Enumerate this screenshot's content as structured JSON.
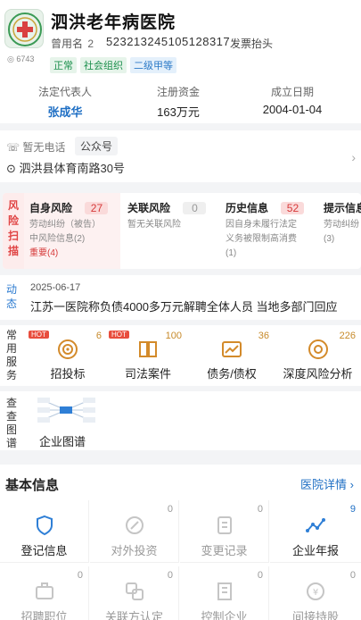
{
  "company": {
    "name": "泗洪老年病医院",
    "former_label": "曾用名",
    "former_count": "2",
    "credit_code": "523213245105128317",
    "invoice_label": "发票抬头",
    "views": "6743",
    "tags": [
      "正常",
      "社会组织",
      "二级甲等"
    ]
  },
  "kpis": [
    {
      "label": "法定代表人",
      "value": "张成华"
    },
    {
      "label": "注册资金",
      "value": "163万元"
    },
    {
      "label": "成立日期",
      "value": "2004-01-04"
    }
  ],
  "contact": {
    "phone": "暂无电话",
    "wechat": "公众号",
    "address": "泗洪县体育南路30号"
  },
  "risk": {
    "side_label": [
      "风",
      "险",
      "扫",
      "描"
    ],
    "columns": [
      {
        "title": "自身风险",
        "count": "27",
        "lines": [
          "劳动纠纷（被告）",
          "中风险信息(2)"
        ],
        "alert": "重要(4)"
      },
      {
        "title": "关联风险",
        "count": "0",
        "lines": [
          "",
          "暂无关联风险"
        ],
        "alert": ""
      },
      {
        "title": "历史信息",
        "count": "52",
        "lines": [
          "因自身未履行法定",
          "义务被限制高消费",
          "(1)"
        ],
        "alert": ""
      },
      {
        "title": "提示信息",
        "count": "",
        "lines": [
          "劳动纠纷",
          "(3)"
        ],
        "alert": ""
      }
    ]
  },
  "dynamic": {
    "side_label": [
      "动",
      "态"
    ],
    "date": "2025-06-17",
    "text": "江苏一医院称负债4000多万元解聘全体人员 当地多部门回应"
  },
  "services": {
    "side_label": [
      "常",
      "用",
      "服",
      "务"
    ],
    "items": [
      {
        "label": "招投标",
        "count": "6",
        "hot": "HOT"
      },
      {
        "label": "司法案件",
        "count": "100",
        "hot": "HOT"
      },
      {
        "label": "债务/债权",
        "count": "36",
        "hot": ""
      },
      {
        "label": "深度风险分析",
        "count": "226",
        "hot": ""
      }
    ]
  },
  "graph": {
    "side_label": [
      "查",
      "查",
      "图",
      "谱"
    ],
    "label": "企业图谱"
  },
  "basic": {
    "title": "基本信息",
    "link": "医院详情",
    "items": [
      {
        "label": "登记信息",
        "count": ""
      },
      {
        "label": "对外投资",
        "count": "0"
      },
      {
        "label": "变更记录",
        "count": "0"
      },
      {
        "label": "企业年报",
        "count": "9"
      },
      {
        "label": "招聘职位",
        "count": "0"
      },
      {
        "label": "关联方认定",
        "count": "0"
      },
      {
        "label": "控制企业",
        "count": "0"
      },
      {
        "label": "间接持股",
        "count": "0"
      }
    ]
  },
  "colors": {
    "accent_blue": "#1f6fc4",
    "risk_red": "#e04545",
    "status_green": "#1b8f4c"
  }
}
